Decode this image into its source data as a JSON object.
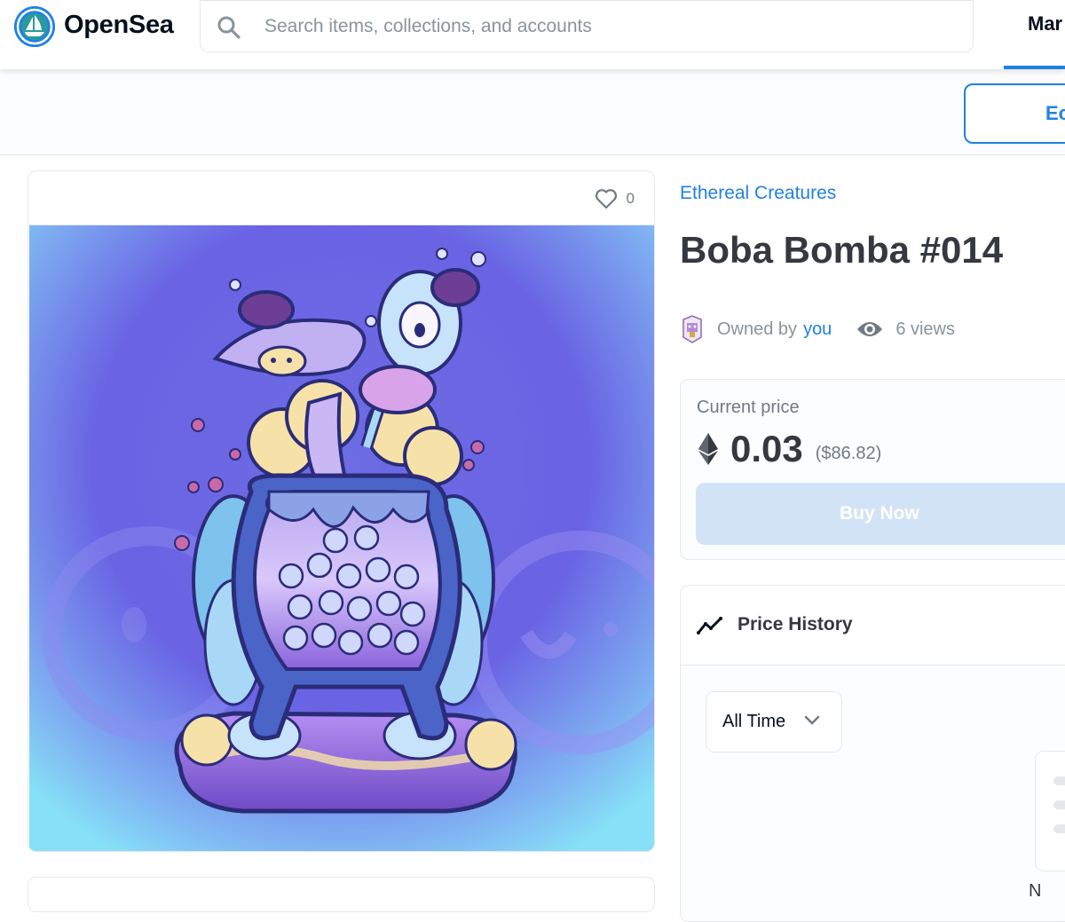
{
  "header": {
    "brand": "OpenSea",
    "search_placeholder": "Search items, collections, and accounts",
    "nav_link": "Mar"
  },
  "actionbar": {
    "edit_label": "Ec"
  },
  "image_card": {
    "favorites_count": "0"
  },
  "item": {
    "collection": "Ethereal Creatures",
    "title": "Boba Bomba #014",
    "owned_by_label": "Owned by",
    "owner": "you",
    "views": "6 views"
  },
  "price": {
    "label": "Current price",
    "value": "0.03",
    "fiat": "($86.82)",
    "buy_label": "Buy Now"
  },
  "price_history": {
    "title": "Price History",
    "range": "All Time",
    "cut_label": "N"
  },
  "colors": {
    "accent": "#2081e2",
    "text": "#353840",
    "muted": "#707a83",
    "border": "#e5e8eb",
    "buy_disabled": "#d3e3f6"
  },
  "icons": [
    "opensea-logo-icon",
    "search-icon",
    "heart-icon",
    "eye-icon",
    "ethereum-icon",
    "trend-line-icon",
    "chevron-down-icon"
  ]
}
